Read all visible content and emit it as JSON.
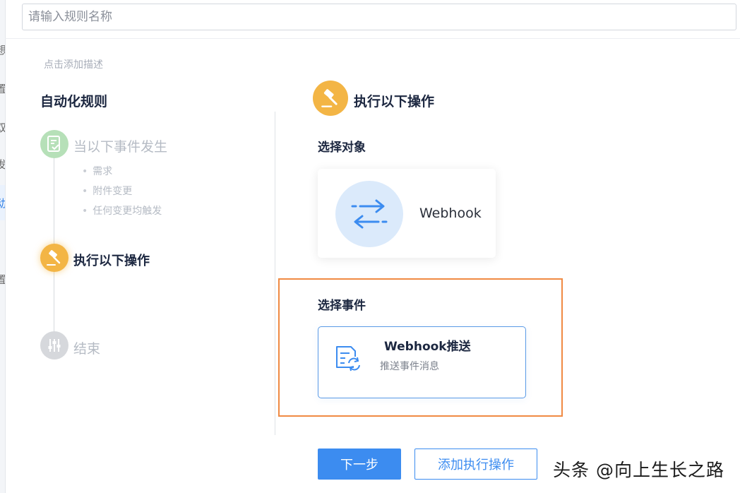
{
  "rule_name": {
    "placeholder": "请输入规则名称",
    "value": ""
  },
  "description_link": "点击添加描述",
  "rule_title": "自动化规则",
  "steps": [
    {
      "label": "当以下事件发生",
      "icon": "document-check-icon",
      "state": "inactive",
      "events": [
        "需求",
        "附件变更",
        "任何变更均触发"
      ]
    },
    {
      "label": "执行以下操作",
      "icon": "gavel-icon",
      "state": "active"
    },
    {
      "label": "结束",
      "icon": "sliders-icon",
      "state": "inactive"
    }
  ],
  "action_panel": {
    "title": "执行以下操作",
    "icon": "gavel-icon",
    "select_target_label": "选择对象",
    "target": {
      "name": "Webhook",
      "icon": "swap-arrows-icon"
    },
    "select_event_label": "选择事件",
    "event": {
      "title": "Webhook推送",
      "description": "推送事件消息",
      "icon": "document-refresh-icon"
    }
  },
  "buttons": {
    "next": "下一步",
    "add_action": "添加执行操作"
  },
  "watermark": "头条 @向上生长之路",
  "sidebar_fragments": [
    "想",
    "置",
    "双",
    "发",
    "动",
    "置"
  ],
  "colors": {
    "primary": "#3c8cf0",
    "warning": "#f3b545",
    "success": "#b6e0b8",
    "highlight": "#f08a43"
  }
}
